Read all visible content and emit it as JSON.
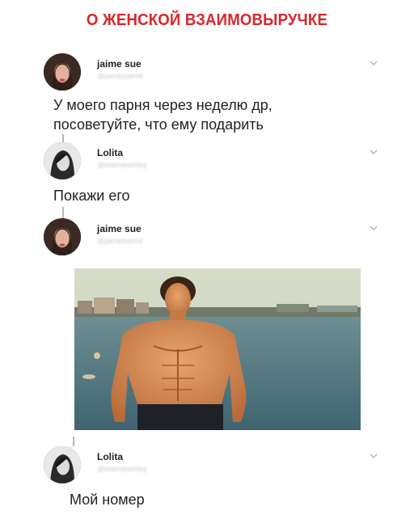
{
  "title": "О ЖЕНСКОЙ ВЗАИМОВЫРУЧКЕ",
  "tweets": [
    {
      "username": "jaime sue",
      "handle": "@jaimesuemil",
      "text_line1": "У моего парня через неделю др,",
      "text_line2": "посоветуйте, что ему подарить"
    },
    {
      "username": "Lolita",
      "handle": "@lolamaserlley",
      "text": "Покажи его"
    },
    {
      "username": "jaime sue",
      "handle": "@jaimesuemil"
    },
    {
      "username": "Lolita",
      "handle": "@lolamaserlley",
      "text": "Мой номер"
    }
  ],
  "colors": {
    "title": "#d8262b",
    "text": "#222222",
    "thread_line": "#b8b8b8",
    "handle": "#c9c9c9"
  },
  "icons": [
    "chevron-down-icon"
  ]
}
